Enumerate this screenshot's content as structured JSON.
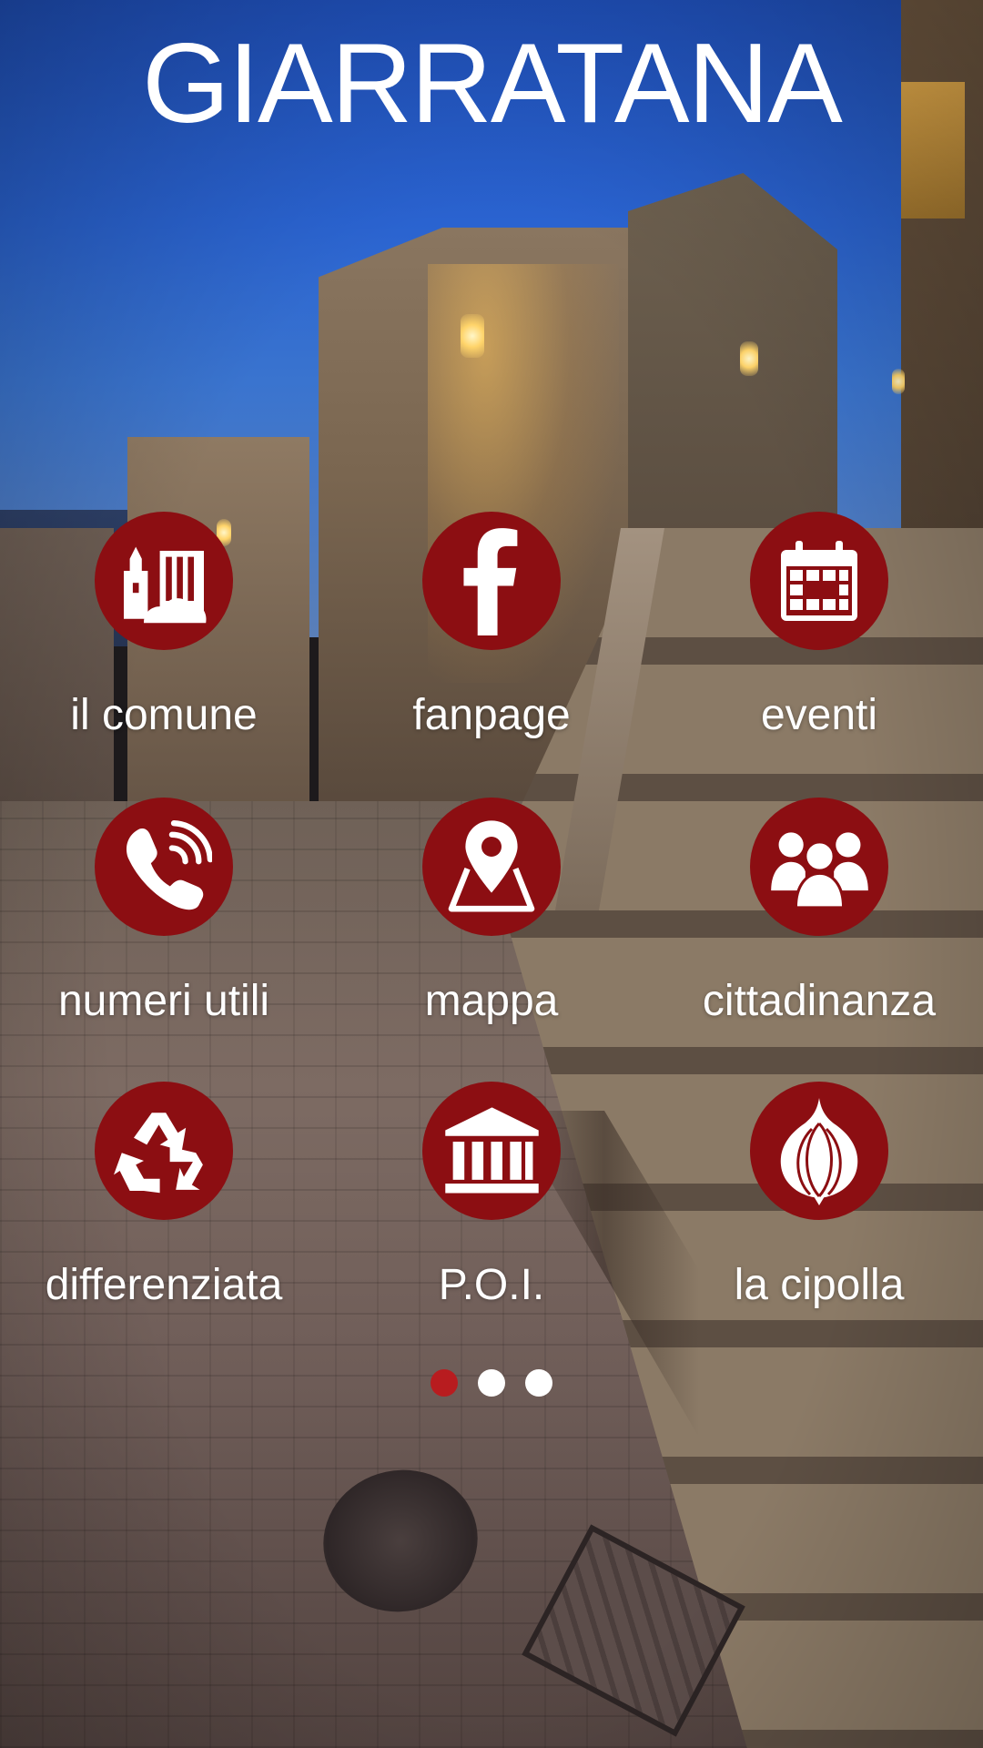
{
  "app": {
    "title": "GIARRATANA"
  },
  "menu": {
    "items": [
      {
        "label": "il comune",
        "icon": "town-hall-icon"
      },
      {
        "label": "fanpage",
        "icon": "facebook-icon"
      },
      {
        "label": "eventi",
        "icon": "calendar-icon"
      },
      {
        "label": "numeri utili",
        "icon": "phone-icon"
      },
      {
        "label": "mappa",
        "icon": "map-pin-icon"
      },
      {
        "label": "cittadinanza",
        "icon": "people-icon"
      },
      {
        "label": "differenziata",
        "icon": "recycle-icon"
      },
      {
        "label": "P.O.I.",
        "icon": "museum-icon"
      },
      {
        "label": "la cipolla",
        "icon": "onion-icon"
      }
    ]
  },
  "pager": {
    "active_index": 0,
    "count": 3
  },
  "colors": {
    "accent": "#8c0e12",
    "dot_active": "#b81c1f",
    "text": "#ffffff"
  }
}
